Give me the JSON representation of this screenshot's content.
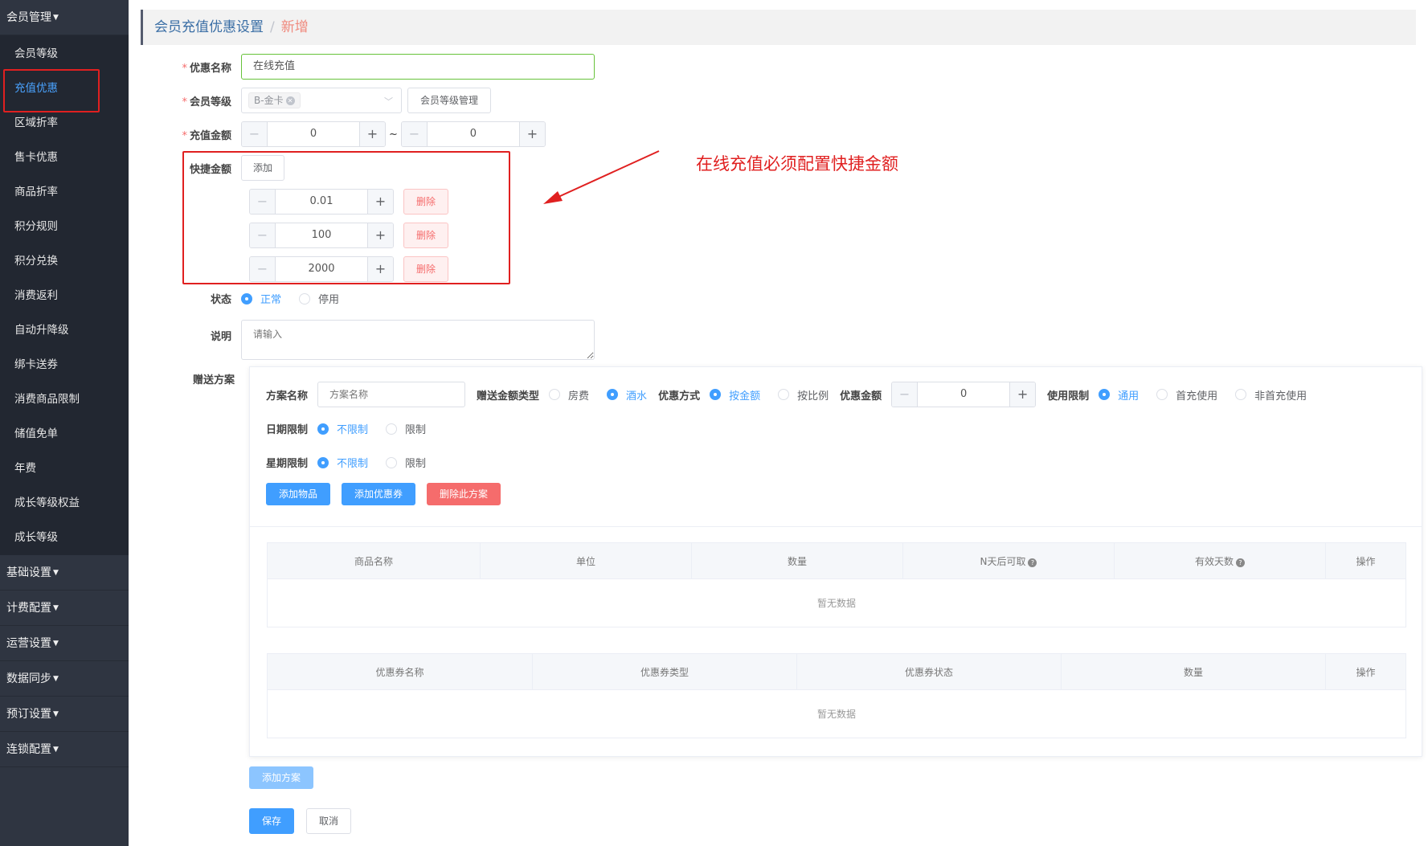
{
  "sidebar": {
    "member_group": "会员管理",
    "items": [
      {
        "label": "会员等级",
        "active": false
      },
      {
        "label": "充值优惠",
        "active": true
      },
      {
        "label": "区域折率",
        "active": false
      },
      {
        "label": "售卡优惠",
        "active": false
      },
      {
        "label": "商品折率",
        "active": false
      },
      {
        "label": "积分规则",
        "active": false
      },
      {
        "label": "积分兑换",
        "active": false
      },
      {
        "label": "消费返利",
        "active": false
      },
      {
        "label": "自动升降级",
        "active": false
      },
      {
        "label": "绑卡送券",
        "active": false
      },
      {
        "label": "消费商品限制",
        "active": false
      },
      {
        "label": "储值免单",
        "active": false
      },
      {
        "label": "年费",
        "active": false
      },
      {
        "label": "成长等级权益",
        "active": false
      },
      {
        "label": "成长等级",
        "active": false
      }
    ],
    "groups": [
      "基础设置",
      "计费配置",
      "运营设置",
      "数据同步",
      "预订设置",
      "连锁配置"
    ]
  },
  "breadcrumb": {
    "parent": "会员充值优惠设置",
    "separator": "/",
    "current": "新增"
  },
  "form": {
    "name_label": "优惠名称",
    "name_value": "在线充值",
    "level_label": "会员等级",
    "level_tag": "B-金卡",
    "level_manage_button": "会员等级管理",
    "amount_label": "充值金额",
    "amount_min": "0",
    "amount_tilde": "~",
    "amount_max": "0",
    "quick_label": "快捷金额",
    "quick_add": "添加",
    "quick_amounts": [
      "0.01",
      "100",
      "2000"
    ],
    "delete_label": "删除",
    "status_label": "状态",
    "status_normal": "正常",
    "status_disabled": "停用",
    "remark_label": "说明",
    "remark_placeholder": "请输入",
    "plan_label": "赠送方案"
  },
  "annotation": "在线充值必须配置快捷金额",
  "plan": {
    "name_label": "方案名称",
    "name_placeholder": "方案名称",
    "gift_type_label": "赠送金额类型",
    "gift_type_room": "房费",
    "gift_type_drink": "酒水",
    "discount_mode_label": "优惠方式",
    "mode_by_amount": "按金额",
    "mode_by_ratio": "按比例",
    "discount_amount_label": "优惠金额",
    "discount_amount": "0",
    "usage_label": "使用限制",
    "usage_general": "通用",
    "usage_first": "首充使用",
    "usage_non_first": "非首充使用",
    "date_label": "日期限制",
    "unlimited": "不限制",
    "limited": "限制",
    "week_label": "星期限制",
    "add_item_button": "添加物品",
    "add_coupon_button": "添加优惠券",
    "delete_plan_button": "删除此方案",
    "goods_table": {
      "headers": [
        "商品名称",
        "单位",
        "数量",
        "N天后可取",
        "有效天数",
        "操作"
      ],
      "empty": "暂无数据"
    },
    "coupon_table": {
      "headers": [
        "优惠券名称",
        "优惠券类型",
        "优惠券状态",
        "数量",
        "操作"
      ],
      "empty": "暂无数据"
    }
  },
  "buttons": {
    "add_plan": "添加方案",
    "save": "保存",
    "cancel": "取消"
  },
  "colors": {
    "primary": "#409eff",
    "danger": "#f56c6c",
    "annotation_red": "#e02020",
    "sidebar_bg": "#2f3541"
  }
}
